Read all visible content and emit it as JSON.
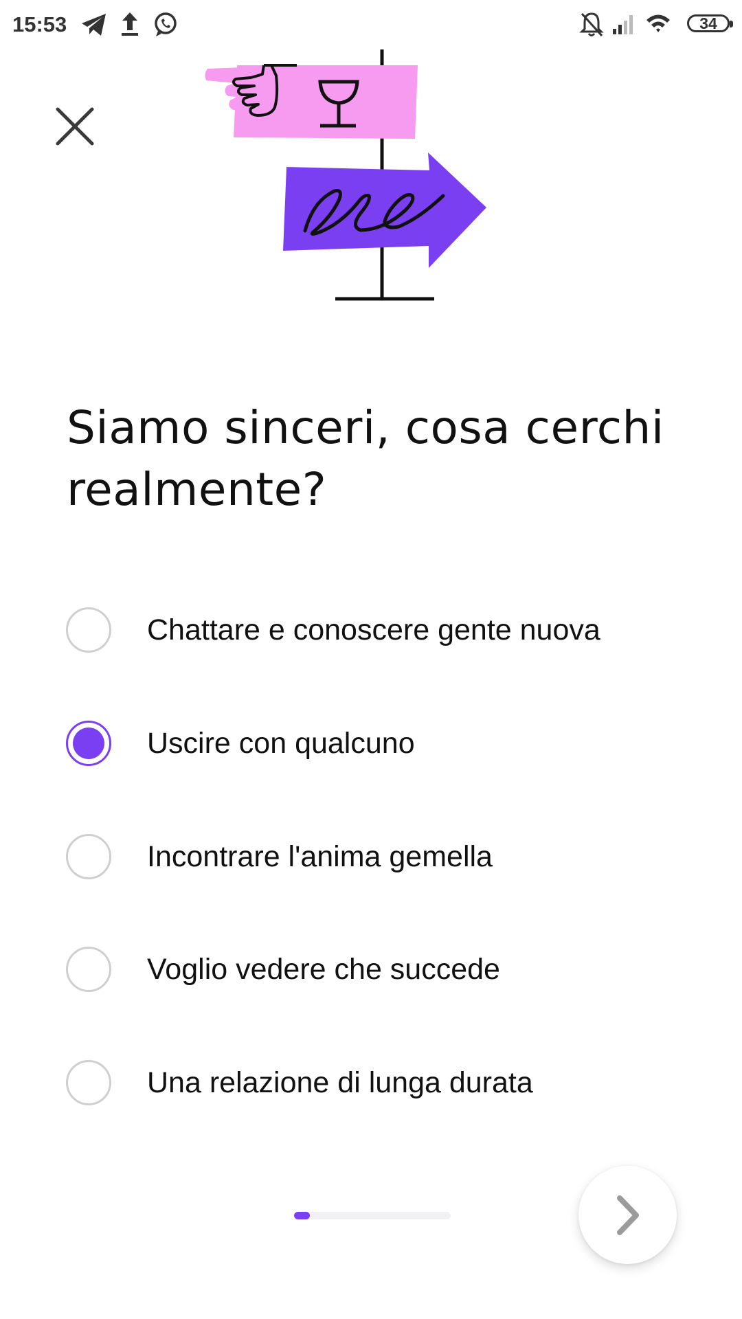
{
  "status_bar": {
    "time": "15:53",
    "battery": "34",
    "left_icons": [
      "telegram-icon",
      "upload-icon",
      "whatsapp-icon"
    ],
    "right_icons": [
      "bell-off-icon",
      "signal-icon",
      "wifi-icon",
      "battery-icon"
    ]
  },
  "question": {
    "title": "Siamo sinceri, cosa cerchi realmente?"
  },
  "options": [
    {
      "label": "Chattare e conoscere gente nuova",
      "selected": false
    },
    {
      "label": "Uscire con qualcuno",
      "selected": true
    },
    {
      "label": "Incontrare l'anima gemella",
      "selected": false
    },
    {
      "label": "Voglio vedere che succede",
      "selected": false
    },
    {
      "label": "Una relazione di lunga durata",
      "selected": false
    }
  ],
  "progress": {
    "fraction": 0.1
  },
  "colors": {
    "accent": "#7b3ff2",
    "sign_pink": "#f79bf0",
    "sign_purple": "#7b3ff2"
  },
  "icons": {
    "close": "close-icon",
    "next": "chevron-right-icon"
  }
}
